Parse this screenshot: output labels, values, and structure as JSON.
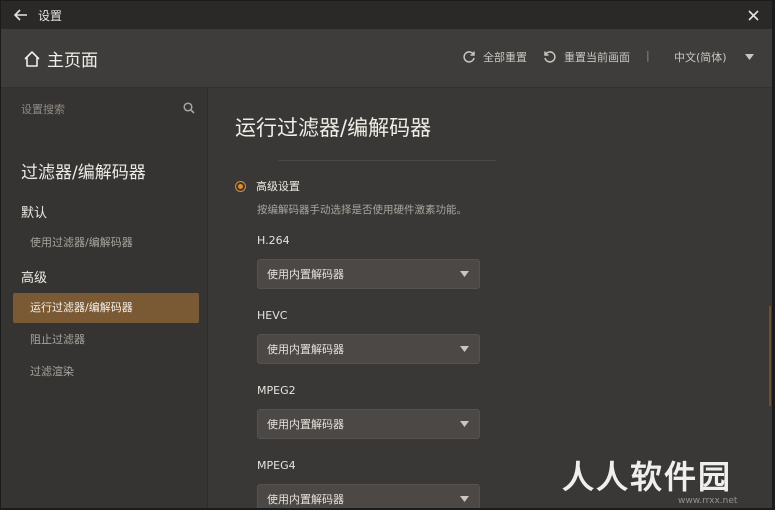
{
  "window": {
    "title": "设置"
  },
  "topbar": {
    "home_label": "主页面",
    "reset_all": "全部重置",
    "reset_page": "重置当前画面",
    "separator": "|",
    "language": "中文(简体)"
  },
  "sidebar": {
    "search_placeholder": "设置搜索",
    "heading": "过滤器/编解码器",
    "groups": [
      {
        "label": "默认",
        "items": [
          {
            "label": "使用过滤器/编解码器"
          }
        ]
      },
      {
        "label": "高级",
        "items": [
          {
            "label": "运行过滤器/编解码器",
            "active": true
          },
          {
            "label": "阻止过滤器"
          },
          {
            "label": "过滤渲染"
          }
        ]
      }
    ]
  },
  "main": {
    "title": "运行过滤器/编解码器",
    "advanced": {
      "label": "高级设置",
      "description": "按编解码器手动选择是否使用硬件激素功能。"
    },
    "codecs": [
      {
        "name": "H.264",
        "value": "使用内置解码器"
      },
      {
        "name": "HEVC",
        "value": "使用内置解码器"
      },
      {
        "name": "MPEG2",
        "value": "使用内置解码器"
      },
      {
        "name": "MPEG4",
        "value": "使用内置解码器"
      }
    ]
  },
  "watermark": {
    "text": "人人软件园",
    "sub": "www.rrxx.net"
  },
  "colors": {
    "accent": "#e08a2c",
    "active_item": "#7a5a34",
    "background": "#3a3836"
  }
}
